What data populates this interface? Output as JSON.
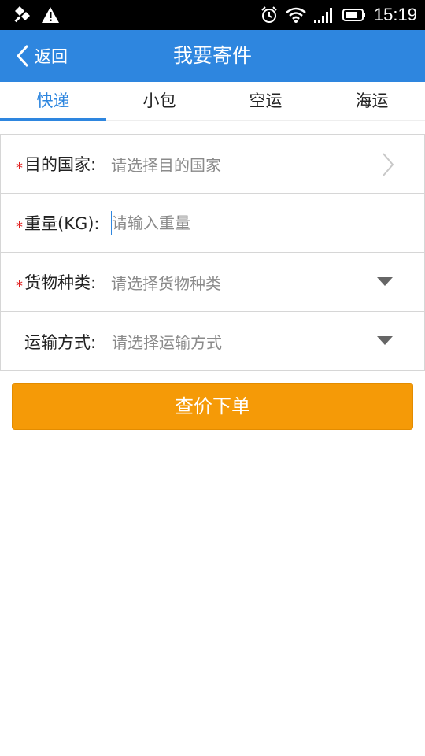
{
  "status_bar": {
    "time": "15:19",
    "icons": [
      "notification-icon",
      "warning-icon",
      "alarm-icon",
      "wifi-icon",
      "signal-icon",
      "battery-icon"
    ]
  },
  "nav": {
    "back_label": "返回",
    "title": "我要寄件"
  },
  "tabs": [
    {
      "label": "快递",
      "active": true
    },
    {
      "label": "小包",
      "active": false
    },
    {
      "label": "空运",
      "active": false
    },
    {
      "label": "海运",
      "active": false
    }
  ],
  "form": {
    "destination": {
      "label": "目的国家:",
      "placeholder": "请选择目的国家",
      "required": true
    },
    "weight": {
      "label": "重量(KG):",
      "placeholder": "请输入重量",
      "required": true
    },
    "goods_type": {
      "label": "货物种类:",
      "placeholder": "请选择货物种类",
      "required": true
    },
    "shipping_method": {
      "label": "运输方式:",
      "placeholder": "请选择运输方式",
      "required": false
    },
    "required_mark": "*"
  },
  "submit": {
    "label": "查价下单"
  },
  "colors": {
    "primary": "#2e86df",
    "accent": "#f59a07",
    "required": "#e02020"
  }
}
